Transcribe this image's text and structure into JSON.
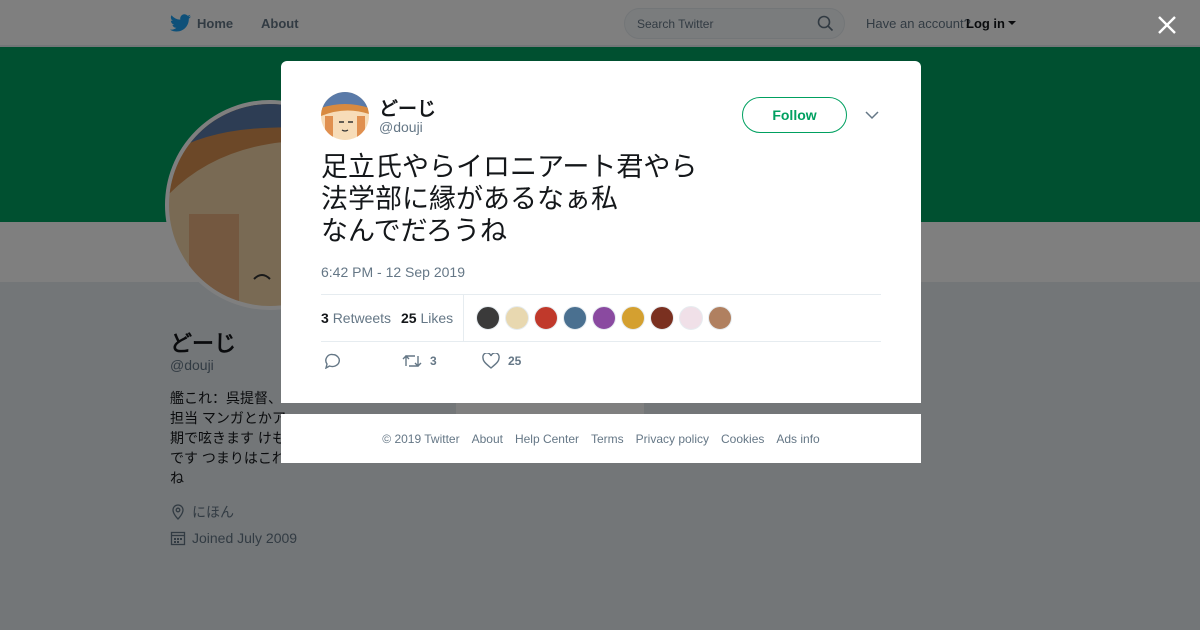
{
  "nav": {
    "home_label": "Home",
    "about_label": "About",
    "search_placeholder": "Search Twitter",
    "have_account": "Have an account?",
    "login_label": "Log in"
  },
  "profile": {
    "name": "どーじ",
    "handle": "@douji",
    "bio": "艦これ：呉提督、\n担当 マンガとかア\n期で呟きます けも\nです つまりはこれ\nね",
    "location": "にほん",
    "joined": "Joined July 2009",
    "banner_color": "#00a060"
  },
  "tweet": {
    "author_name": "どーじ",
    "author_handle": "@douji",
    "follow_label": "Follow",
    "text": "足立氏やらイロニアート君やら\n法学部に縁があるなぁ私\nなんでだろうね",
    "timestamp": "6:42 PM - 12 Sep 2019",
    "retweets_count": "3",
    "retweets_label": "Retweets",
    "likes_count": "25",
    "likes_label": "Likes",
    "action_retweet_count": "3",
    "action_like_count": "25",
    "liker_avatar_colors": [
      "#3a3a3a",
      "#e8d8b0",
      "#c0392b",
      "#4a7090",
      "#8a4aa0",
      "#d4a030",
      "#7a3020",
      "#f0e0e8",
      "#b08060"
    ]
  },
  "footer": {
    "copyright": "© 2019 Twitter",
    "about": "About",
    "help": "Help Center",
    "terms": "Terms",
    "privacy": "Privacy policy",
    "cookies": "Cookies",
    "ads": "Ads info"
  },
  "colors": {
    "accent": "#00a060",
    "twitter_blue": "#1da1f2",
    "muted": "#657786"
  }
}
